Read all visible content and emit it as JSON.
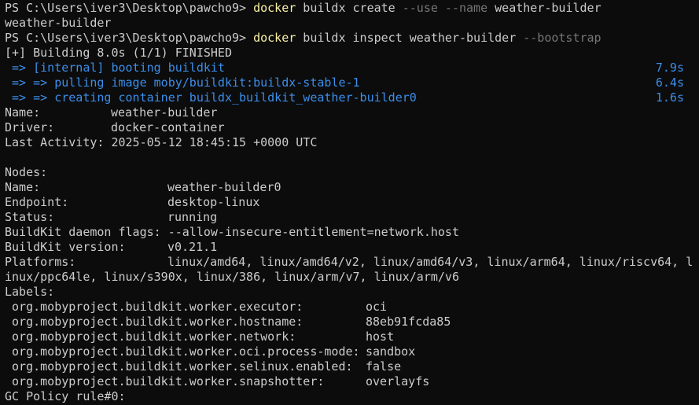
{
  "colors": {
    "background": "#0c0c0c",
    "text": "#cccccc",
    "command": "#f9f1a5",
    "flag": "#767676",
    "build_step": "#3b8eea"
  },
  "cmd1": {
    "prompt": "PS C:\\Users\\iver3\\Desktop\\pawcho9> ",
    "program": "docker",
    "args": " buildx create ",
    "flags": "--use --name",
    "rest": " weather-builder"
  },
  "out1": "weather-builder",
  "cmd2": {
    "prompt": "PS C:\\Users\\iver3\\Desktop\\pawcho9> ",
    "program": "docker",
    "args": " buildx inspect weather-builder ",
    "flags": "--bootstrap"
  },
  "building": "[+] Building 8.0s (1/1) FINISHED",
  "steps": [
    {
      "text": " => [internal] booting buildkit",
      "time": "7.9s"
    },
    {
      "text": " => => pulling image moby/buildkit:buildx-stable-1",
      "time": "6.4s"
    },
    {
      "text": " => => creating container buildx_buildkit_weather-builder0",
      "time": "1.6s"
    }
  ],
  "builder": [
    {
      "key": "Name:",
      "value": "weather-builder"
    },
    {
      "key": "Driver:",
      "value": "docker-container"
    },
    {
      "key": "Last Activity:",
      "value": "2025-05-12 18:45:15 +0000 UTC"
    }
  ],
  "nodes_header": "Nodes:",
  "node": [
    {
      "key": "Name:",
      "value": "weather-builder0"
    },
    {
      "key": "Endpoint:",
      "value": "desktop-linux"
    },
    {
      "key": "Status:",
      "value": "running"
    },
    {
      "key": "BuildKit daemon flags:",
      "value": "--allow-insecure-entitlement=network.host"
    },
    {
      "key": "BuildKit version:",
      "value": "v0.21.1"
    },
    {
      "key": "Platforms:",
      "value": "linux/amd64, linux/amd64/v2, linux/amd64/v3, linux/arm64, linux/riscv64, l"
    }
  ],
  "platforms_wrap": "inux/ppc64le, linux/s390x, linux/386, linux/arm/v7, linux/arm/v6",
  "labels_header": "Labels:",
  "labels": [
    {
      "key": " org.mobyproject.buildkit.worker.executor:",
      "value": "oci"
    },
    {
      "key": " org.mobyproject.buildkit.worker.hostname:",
      "value": "88eb91fcda85"
    },
    {
      "key": " org.mobyproject.buildkit.worker.network:",
      "value": "host"
    },
    {
      "key": " org.mobyproject.buildkit.worker.oci.process-mode:",
      "value": "sandbox"
    },
    {
      "key": " org.mobyproject.buildkit.worker.selinux.enabled:",
      "value": "false"
    },
    {
      "key": " org.mobyproject.buildkit.worker.snapshotter:",
      "value": "overlayfs"
    }
  ],
  "gc_policy": "GC Policy rule#0:"
}
